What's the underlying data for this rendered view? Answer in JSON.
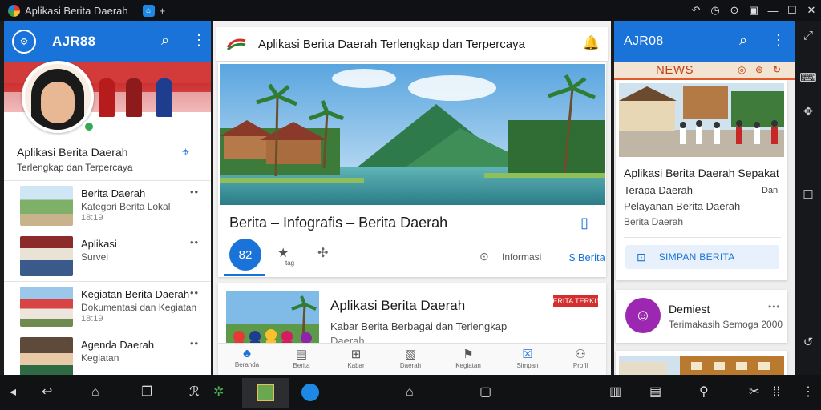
{
  "window": {
    "title": "Aplikasi Berita Daerah",
    "tab_icon": "app-tab-icon",
    "controls": [
      "↶",
      "◷",
      "⊙",
      "▣",
      "—",
      "☐",
      "✕"
    ]
  },
  "left_pane": {
    "app_name": "AJR88",
    "logo_text": "⚙",
    "profile": {
      "title": "Aplikasi Berita Daerah",
      "subtitle": "Terlengkap dan Terpercaya"
    },
    "items": [
      {
        "title": "Berita Daerah",
        "subtitle": "Kategori Berita Lokal",
        "meta": "18:19"
      },
      {
        "title": "Aplikasi",
        "subtitle": "Survei",
        "meta": ""
      },
      {
        "title": "Kegiatan Berita Daerah",
        "subtitle": "Dokumentasi dan Kegiatan",
        "meta": "18:19"
      },
      {
        "title": "Agenda Daerah",
        "subtitle": "Kegiatan",
        "meta": ""
      }
    ]
  },
  "mid_pane": {
    "top_title": "Aplikasi Berita Daerah Terlengkap dan Terpercaya",
    "main_card": {
      "title": "Berita – Infografis – Berita Daerah",
      "score": "82",
      "pin_sub": "tag",
      "stat": "Informasi",
      "price": "$ Berita"
    },
    "second_card": {
      "title": "Aplikasi Berita Daerah",
      "line1": "Kabar Berita Berbagai dan Terlengkap",
      "line2": "Daerah",
      "tag": "BERITA TERKINI"
    },
    "tabs": [
      {
        "label": "Beranda",
        "icon": "♣"
      },
      {
        "label": "Berita",
        "icon": "▤"
      },
      {
        "label": "Kabar",
        "icon": "⊞"
      },
      {
        "label": "Daerah",
        "icon": "▧"
      },
      {
        "label": "Kegiatan",
        "icon": "⚑"
      },
      {
        "label": "Simpan",
        "icon": "☒"
      },
      {
        "label": "Profil",
        "icon": "⚇"
      }
    ]
  },
  "right_pane": {
    "app_name": "AJR08",
    "banner": "NEWS",
    "card": {
      "title": "Aplikasi Berita Daerah Sepakat",
      "line1": "Terapa Daerah",
      "line1_right": "Dan",
      "line2": "Pelayanan Berita Daerah",
      "line3": "Berita Daerah",
      "button": "SIMPAN BERITA"
    },
    "contact": {
      "initial": "☺",
      "name": "Demiest",
      "subtitle": "Terimakasih Semoga 2000"
    }
  },
  "colors": {
    "primary": "#1a73d9",
    "title_bar": "#101114",
    "nav_bar": "#111214",
    "accent_red": "#d32f2f",
    "news_orange": "#e55d2b",
    "avatar_purple": "#9c27b0"
  }
}
